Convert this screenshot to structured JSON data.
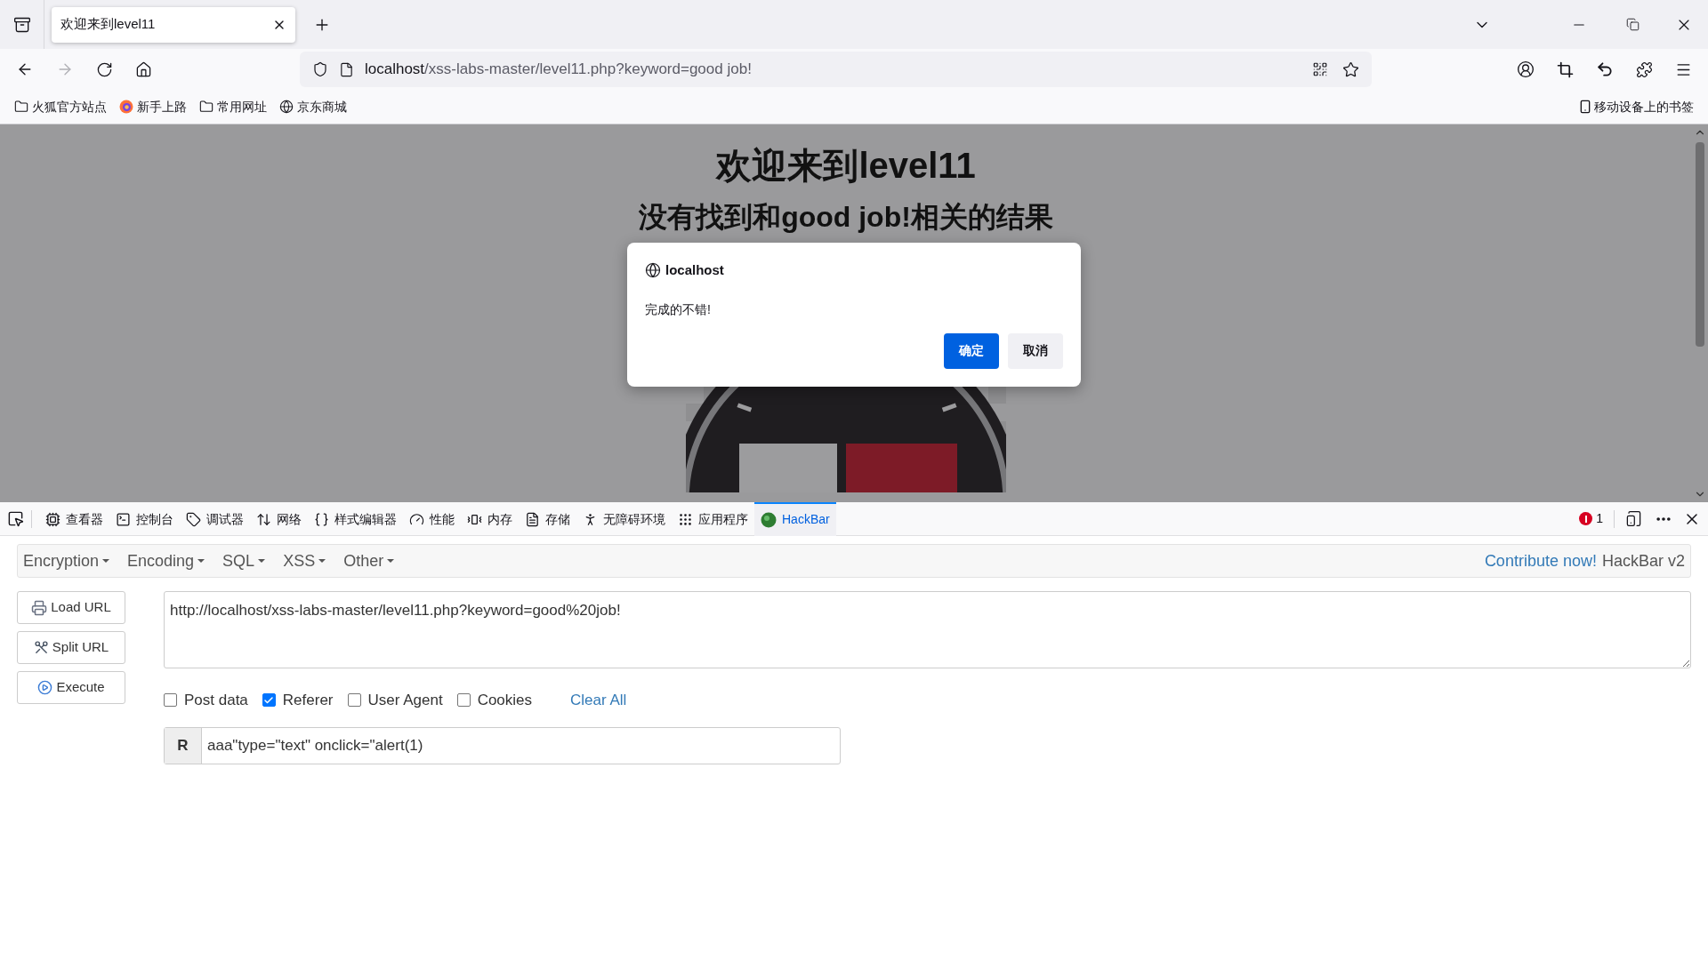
{
  "browser": {
    "tabs": [
      {
        "title": "欢迎来到level11",
        "selected": true
      }
    ],
    "address": {
      "host": "localhost",
      "path": "/xss-labs-master/level11.php?keyword=good job!"
    },
    "bookmarks": [
      {
        "label": "火狐官方站点",
        "kind": "folder"
      },
      {
        "label": "新手上路",
        "kind": "firefox"
      },
      {
        "label": "常用网址",
        "kind": "folder"
      },
      {
        "label": "京东商城",
        "kind": "globe"
      }
    ],
    "mobile_bookmarks": "移动设备上的书签"
  },
  "page": {
    "heading": "欢迎来到level11",
    "subheading": "没有找到和good job!相关的结果"
  },
  "dialog": {
    "origin": "localhost",
    "message": "完成的不错!",
    "buttons": [
      {
        "label": "确定",
        "primary": true
      },
      {
        "label": "取消",
        "primary": false
      }
    ]
  },
  "devtools": {
    "tools": [
      {
        "label": "查看器",
        "kind": "inspector",
        "selected": false
      },
      {
        "label": "控制台",
        "kind": "console",
        "selected": false
      },
      {
        "label": "调试器",
        "kind": "debugger",
        "selected": false
      },
      {
        "label": "网络",
        "kind": "network",
        "selected": false
      },
      {
        "label": "样式编辑器",
        "kind": "style",
        "selected": false
      },
      {
        "label": "性能",
        "kind": "performance",
        "selected": false
      },
      {
        "label": "内存",
        "kind": "memory",
        "selected": false
      },
      {
        "label": "存储",
        "kind": "storage",
        "selected": false
      },
      {
        "label": "无障碍环境",
        "kind": "accessibility",
        "selected": false
      },
      {
        "label": "应用程序",
        "kind": "application",
        "selected": false
      },
      {
        "label": "HackBar",
        "kind": "hackbar",
        "selected": true
      }
    ],
    "error_count": "1"
  },
  "hackbar": {
    "menus": [
      "Encryption",
      "Encoding",
      "SQL",
      "XSS",
      "Other"
    ],
    "contribute": "Contribute now!",
    "version": "HackBar v2",
    "actions": [
      {
        "label": "Load URL",
        "kind": "load"
      },
      {
        "label": "Split URL",
        "kind": "split"
      },
      {
        "label": "Execute",
        "kind": "execute"
      }
    ],
    "url": "http://localhost/xss-labs-master/level11.php?keyword=good%20job!",
    "options": [
      {
        "label": "Post data",
        "checked": false
      },
      {
        "label": "Referer",
        "checked": true
      },
      {
        "label": "User Agent",
        "checked": false
      },
      {
        "label": "Cookies",
        "checked": false
      }
    ],
    "clear_all": "Clear All",
    "referer": {
      "prefix": "R",
      "value": "aaa\"type=\"text\" onclick=\"alert(1)"
    }
  }
}
